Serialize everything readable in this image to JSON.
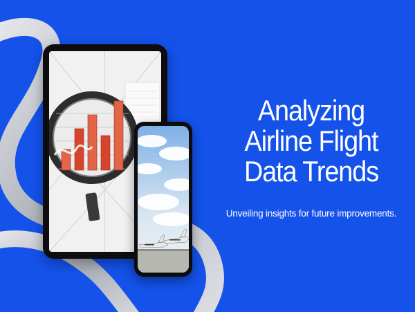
{
  "slide": {
    "background_color": "#1452ea",
    "ribbon_color": "#c9ccd3",
    "headline_lines": [
      "Analyzing",
      "Airline Flight",
      "Data Trends"
    ],
    "subtitle": "Unveiling insights for future improvements."
  },
  "tablet": {
    "screen_image": "magnifying-glass-over-bar-chart",
    "bar_chart_values": [
      3,
      6,
      8,
      5,
      10
    ]
  },
  "phone": {
    "screen_image": "private-jets-on-tarmac"
  }
}
